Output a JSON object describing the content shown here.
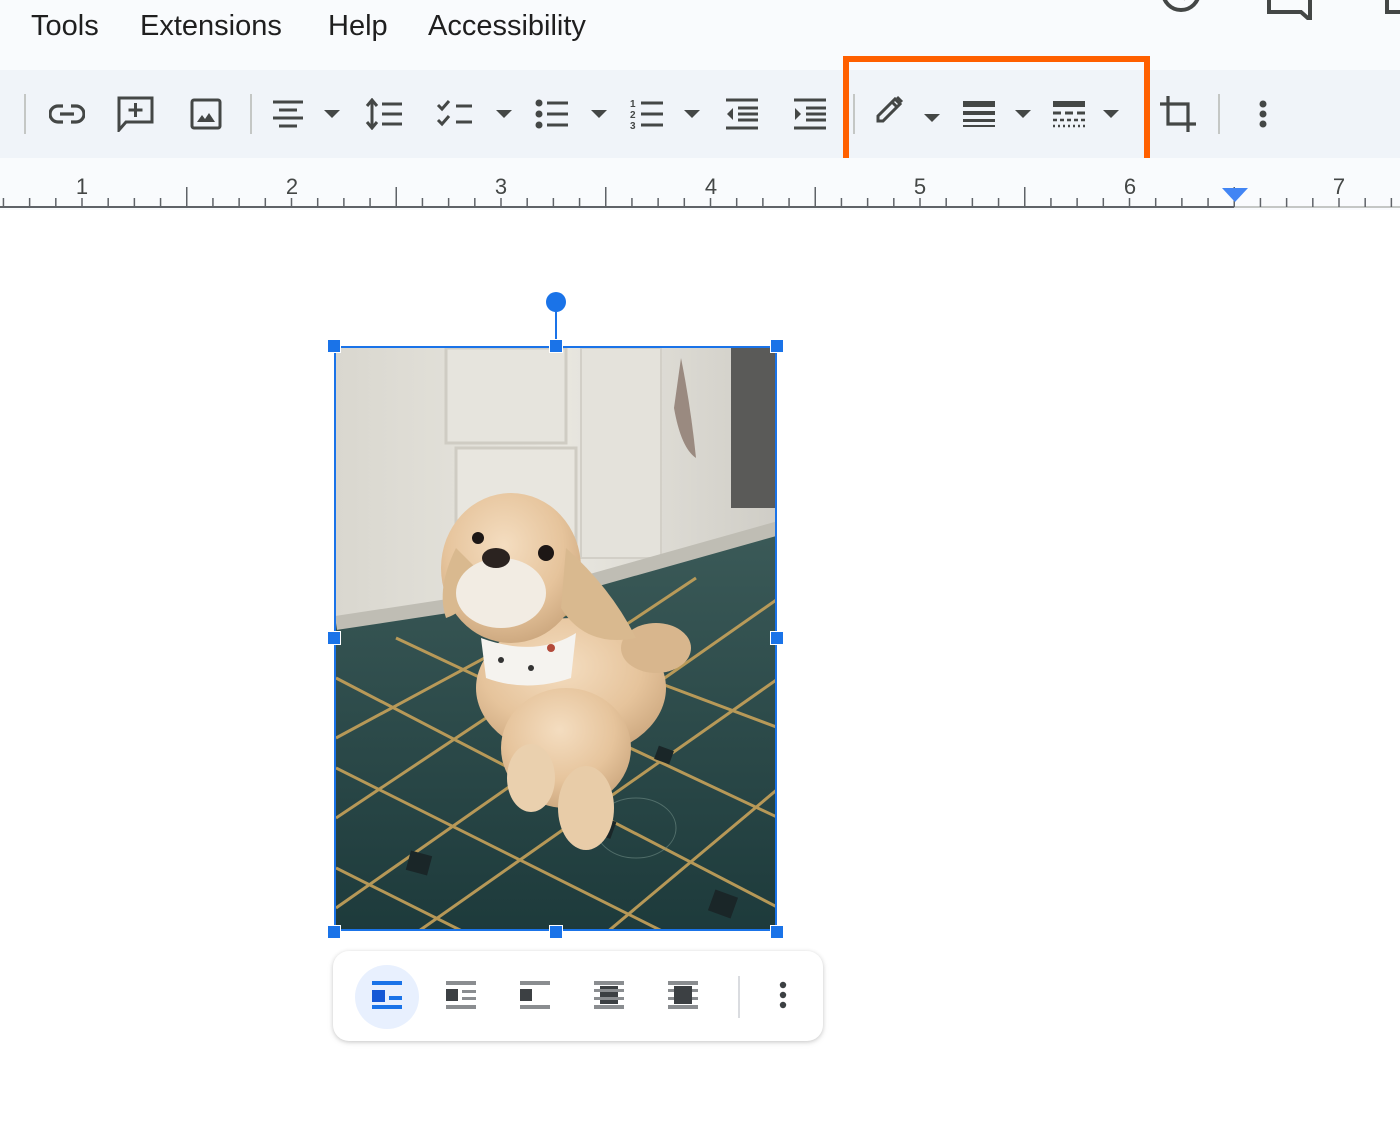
{
  "menubar": {
    "items": [
      {
        "label": "Tools"
      },
      {
        "label": "Extensions"
      },
      {
        "label": "Help"
      },
      {
        "label": "Accessibility"
      }
    ],
    "right_icons": [
      "history-icon",
      "comment-icon",
      "share-icon"
    ]
  },
  "toolbar": {
    "buttons": [
      {
        "name": "insert-link",
        "icon": "link-icon"
      },
      {
        "name": "add-comment",
        "icon": "add-comment-icon"
      },
      {
        "name": "insert-image",
        "icon": "image-icon"
      },
      {
        "name": "align",
        "icon": "align-center-icon",
        "dropdown": true
      },
      {
        "name": "line-spacing",
        "icon": "line-spacing-icon"
      },
      {
        "name": "checklist",
        "icon": "checklist-icon",
        "dropdown": true
      },
      {
        "name": "bulleted-list",
        "icon": "bulleted-list-icon",
        "dropdown": true
      },
      {
        "name": "numbered-list",
        "icon": "numbered-list-icon",
        "dropdown": true
      },
      {
        "name": "decrease-indent",
        "icon": "decrease-indent-icon"
      },
      {
        "name": "increase-indent",
        "icon": "increase-indent-icon"
      },
      {
        "name": "border-color",
        "icon": "pencil-icon",
        "dropdown": true
      },
      {
        "name": "border-weight",
        "icon": "border-weight-icon",
        "dropdown": true
      },
      {
        "name": "border-dash",
        "icon": "border-dash-icon",
        "dropdown": true
      },
      {
        "name": "crop-image",
        "icon": "crop-icon"
      },
      {
        "name": "more-options",
        "icon": "more-vert-icon"
      }
    ],
    "highlight_color": "#ff6000"
  },
  "ruler": {
    "numbers": [
      "1",
      "2",
      "3",
      "4",
      "5",
      "6",
      "7"
    ],
    "right_indent_marker_inches": 6.5
  },
  "image": {
    "description": "Pekingese dog wearing a white bandana sitting on a green octagon-tiled kitchen floor",
    "selection_color": "#1a73e8"
  },
  "wrap_toolbar": {
    "options": [
      {
        "name": "in-line",
        "icon": "wrap-inline-icon",
        "active": true
      },
      {
        "name": "wrap-text",
        "icon": "wrap-text-icon",
        "active": false
      },
      {
        "name": "break-text",
        "icon": "break-text-icon",
        "active": false
      },
      {
        "name": "behind-text",
        "icon": "behind-text-icon",
        "active": false
      },
      {
        "name": "in-front-of-text",
        "icon": "in-front-of-text-icon",
        "active": false
      }
    ],
    "more_icon": "more-vert-icon"
  }
}
